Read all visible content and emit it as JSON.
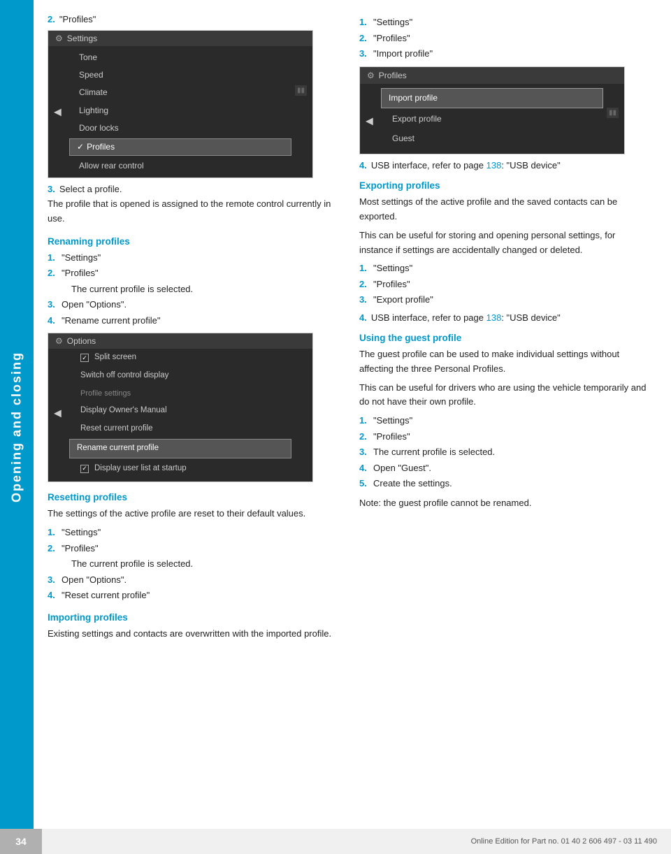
{
  "sidebar": {
    "label": "Opening and closing"
  },
  "page": {
    "number": "34",
    "footer": "Online Edition for Part no. 01 40 2 606 497 - 03 11 490"
  },
  "left_column": {
    "intro_step": {
      "num": "2.",
      "text": "\"Profiles\""
    },
    "step3": {
      "num": "3.",
      "text": "Select a profile."
    },
    "desc": "The profile that is opened is assigned to the remote control currently in use.",
    "renaming_heading": "Renaming profiles",
    "renaming_steps": [
      {
        "num": "1.",
        "text": "\"Settings\""
      },
      {
        "num": "2.",
        "text": "\"Profiles\""
      },
      {
        "num": "",
        "text": "The current profile is selected."
      },
      {
        "num": "3.",
        "text": "Open \"Options\"."
      },
      {
        "num": "4.",
        "text": "\"Rename current profile\""
      }
    ],
    "resetting_heading": "Resetting profiles",
    "resetting_desc": "The settings of the active profile are reset to their default values.",
    "resetting_steps": [
      {
        "num": "1.",
        "text": "\"Settings\""
      },
      {
        "num": "2.",
        "text": "\"Profiles\""
      },
      {
        "num": "",
        "text": "The current profile is selected."
      },
      {
        "num": "3.",
        "text": "Open \"Options\"."
      },
      {
        "num": "4.",
        "text": "\"Reset current profile\""
      }
    ],
    "importing_heading": "Importing profiles",
    "importing_desc": "Existing settings and contacts are overwritten with the imported profile."
  },
  "right_column": {
    "import_steps": [
      {
        "num": "1.",
        "text": "\"Settings\""
      },
      {
        "num": "2.",
        "text": "\"Profiles\""
      },
      {
        "num": "3.",
        "text": "\"Import profile\""
      }
    ],
    "import_step4_num": "4.",
    "import_step4_text": "USB interface, refer to page",
    "import_step4_link": "138",
    "import_step4_suffix": ": \"USB device\"",
    "exporting_heading": "Exporting profiles",
    "exporting_desc1": "Most settings of the active profile and the saved contacts can be exported.",
    "exporting_desc2": "This can be useful for storing and opening personal settings, for instance if settings are accidentally changed or deleted.",
    "exporting_steps": [
      {
        "num": "1.",
        "text": "\"Settings\""
      },
      {
        "num": "2.",
        "text": "\"Profiles\""
      },
      {
        "num": "3.",
        "text": "\"Export profile\""
      }
    ],
    "export_step4_num": "4.",
    "export_step4_text": "USB interface, refer to page",
    "export_step4_link": "138",
    "export_step4_suffix": ": \"USB device\"",
    "guest_heading": "Using the guest profile",
    "guest_desc1": "The guest profile can be used to make individual settings without affecting the three Personal Profiles.",
    "guest_desc2": "This can be useful for drivers who are using the vehicle temporarily and do not have their own profile.",
    "guest_steps": [
      {
        "num": "1.",
        "text": "\"Settings\""
      },
      {
        "num": "2.",
        "text": "\"Profiles\""
      },
      {
        "num": "3.",
        "text": "The current profile is selected."
      },
      {
        "num": "4.",
        "text": "Open \"Guest\"."
      },
      {
        "num": "5.",
        "text": "Create the settings."
      }
    ],
    "guest_note": "Note: the guest profile cannot be renamed."
  },
  "settings_screen": {
    "title": "Settings",
    "items": [
      "Tone",
      "Speed",
      "Climate",
      "Lighting",
      "Door locks",
      "Profiles",
      "Allow rear control"
    ],
    "selected_item": "Profiles"
  },
  "options_screen": {
    "title": "Options",
    "items": [
      {
        "type": "checkbox",
        "checked": true,
        "label": "Split screen"
      },
      {
        "type": "plain",
        "label": "Switch off control display"
      },
      {
        "type": "section",
        "label": "Profile settings"
      },
      {
        "type": "plain",
        "label": "Display Owner's Manual"
      },
      {
        "type": "plain",
        "label": "Reset current profile"
      },
      {
        "type": "highlighted",
        "label": "Rename current profile"
      },
      {
        "type": "checkbox",
        "checked": true,
        "label": "Display user list at startup"
      }
    ]
  },
  "profiles_screen": {
    "title": "Profiles",
    "items": [
      "Import profile",
      "Export profile",
      "Guest"
    ],
    "highlighted_item": "Import profile"
  }
}
